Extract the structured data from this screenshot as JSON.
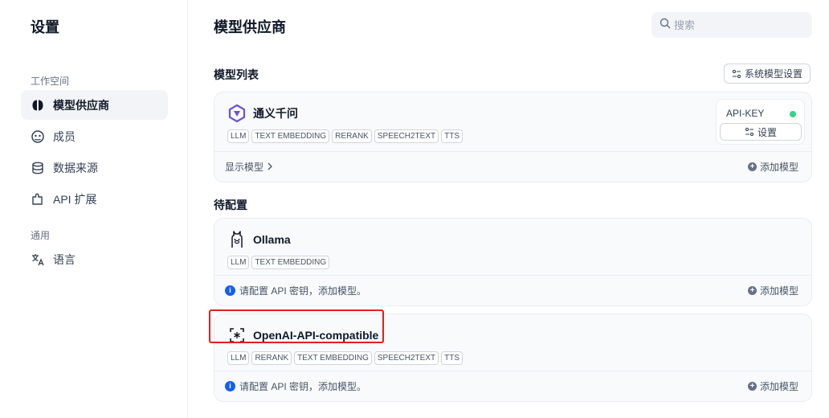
{
  "sidebar": {
    "title": "设置",
    "group_workspace": "工作空间",
    "group_general": "通用",
    "items": [
      {
        "label": "模型供应商",
        "icon": "brain-icon",
        "active": true
      },
      {
        "label": "成员",
        "icon": "members-icon",
        "active": false
      },
      {
        "label": "数据来源",
        "icon": "database-icon",
        "active": false
      },
      {
        "label": "API 扩展",
        "icon": "puzzle-icon",
        "active": false
      },
      {
        "label": "语言",
        "icon": "translate-icon",
        "active": false
      }
    ]
  },
  "header": {
    "title": "模型供应商",
    "search_placeholder": "搜索"
  },
  "model_list": {
    "title": "模型列表",
    "system_settings_label": "系统模型设置"
  },
  "providers_configured": [
    {
      "name": "通义千问",
      "icon": "tongyi-logo-icon",
      "tags": [
        "LLM",
        "TEXT EMBEDDING",
        "RERANK",
        "SPEECH2TEXT",
        "TTS"
      ],
      "show_models_label": "显示模型",
      "add_model_label": "添加模型",
      "api_key_label": "API-KEY",
      "settings_label": "设置",
      "status_color": "#32d583"
    }
  ],
  "pending": {
    "title": "待配置",
    "providers": [
      {
        "name": "Ollama",
        "icon": "llama-icon",
        "tags": [
          "LLM",
          "TEXT EMBEDDING"
        ],
        "hint": "请配置 API 密钥，添加模型。",
        "add_model_label": "添加模型"
      },
      {
        "name": "OpenAI-API-compatible",
        "icon": "openai-compatible-icon",
        "tags": [
          "LLM",
          "RERANK",
          "TEXT EMBEDDING",
          "SPEECH2TEXT",
          "TTS"
        ],
        "hint": "请配置 API 密钥，添加模型。",
        "add_model_label": "添加模型"
      }
    ]
  },
  "colors": {
    "accent": "#155eef",
    "highlight": "#e0201c",
    "status_ok": "#32d583"
  }
}
